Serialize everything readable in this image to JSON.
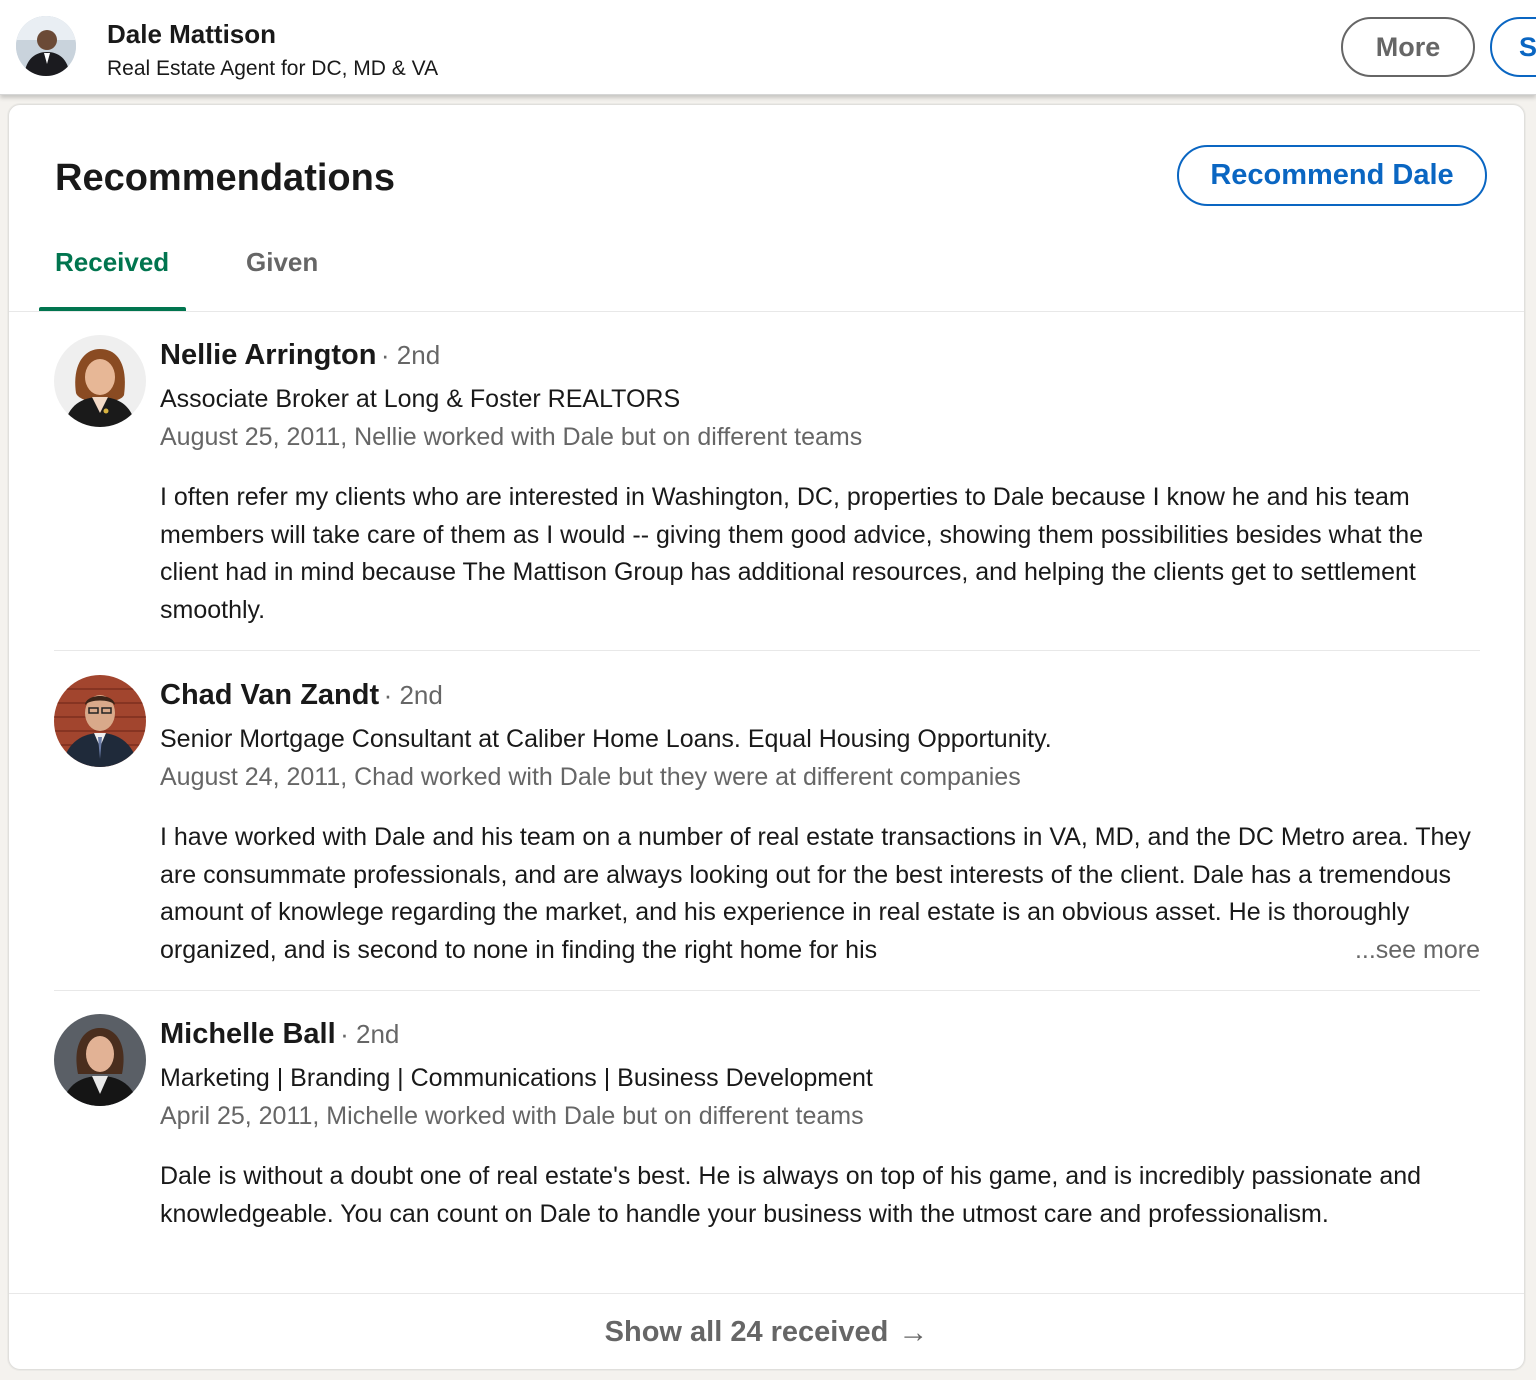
{
  "header": {
    "name": "Dale Mattison",
    "headline": "Real Estate Agent for DC, MD & VA",
    "more_label": "More",
    "cut_button_label": "S"
  },
  "recommendations": {
    "title": "Recommendations",
    "recommend_button": "Recommend Dale",
    "tabs": [
      {
        "label": "Received",
        "active": true
      },
      {
        "label": "Given",
        "active": false
      }
    ],
    "items": [
      {
        "name": "Nellie Arrington",
        "degree": "· 2nd",
        "headline": "Associate Broker at Long & Foster REALTORS",
        "meta": "August 25, 2011, Nellie worked with Dale but on different teams",
        "text": "I often refer my clients who are interested in Washington, DC, properties to Dale because I know he and his team members will take care of them as I would -- giving them good advice, showing them possibilities besides what the client had in mind because The Mattison Group has additional resources, and helping the clients get to settlement smoothly."
      },
      {
        "name": "Chad Van Zandt",
        "degree": "· 2nd",
        "headline": "Senior Mortgage Consultant at Caliber Home Loans. Equal Housing Opportunity.",
        "meta": "August 24, 2011, Chad worked with Dale but they were at different companies",
        "text": "I have worked with Dale and his team on a number of real estate transactions in VA, MD, and the DC Metro area. They are consummate professionals, and are always looking out for the best interests of the client. Dale has a tremendous amount of knowlege regarding the market, and his experience in real estate is an obvious asset. He is thoroughly organized, and is second to none in finding the right home for his",
        "see_more": "...see more"
      },
      {
        "name": "Michelle Ball",
        "degree": "· 2nd",
        "headline": "Marketing | Branding | Communications | Business Development",
        "meta": "April 25, 2011, Michelle worked with Dale but on different teams",
        "text": "Dale is without a doubt one of real estate's best. He is always on top of his game, and is incredibly passionate and knowledgeable. You can count on Dale to handle your business with the utmost care and professionalism."
      }
    ],
    "show_all": "Show all 24 received",
    "show_all_arrow": "→"
  },
  "colors": {
    "accent_blue": "#0a66c2",
    "active_tab_green": "#01754f",
    "secondary_text": "#666666"
  }
}
